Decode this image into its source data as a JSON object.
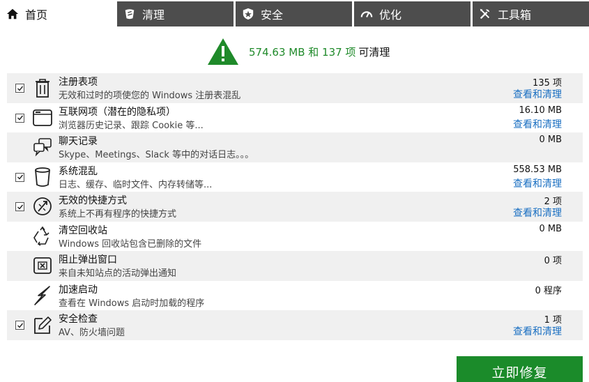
{
  "tabs": [
    {
      "label": "首页",
      "icon": "home-icon",
      "active": true
    },
    {
      "label": "清理",
      "icon": "broom-icon",
      "active": false
    },
    {
      "label": "安全",
      "icon": "shield-icon",
      "active": false
    },
    {
      "label": "优化",
      "icon": "speedometer-icon",
      "active": false
    },
    {
      "label": "工具箱",
      "icon": "tools-icon",
      "active": false
    }
  ],
  "summary": {
    "amount": "574.63 MB 和 137 项",
    "tail": "可清理",
    "icon": "warning-triangle-icon",
    "color": "#1f8a2a"
  },
  "items": [
    {
      "title": "注册表项",
      "desc": "无效和过时的项使您的 Windows 注册表混乱",
      "value": "135 项",
      "link": "查看和清理",
      "checked": true,
      "icon": "trash-icon"
    },
    {
      "title": "互联网项（潜在的隐私项）",
      "desc": "浏览器历史记录、跟踪 Cookie 等...",
      "value": "16.10 MB",
      "link": "查看和清理",
      "checked": true,
      "icon": "browser-window-icon"
    },
    {
      "title": "聊天记录",
      "desc": "Skype、Meetings、Slack 等中的对话日志。。。",
      "value": "0 MB",
      "link": "",
      "checked": false,
      "icon": "chat-icon"
    },
    {
      "title": "系统混乱",
      "desc": "日志、缓存、临时文件、内存转储等...",
      "value": "558.53 MB",
      "link": "查看和清理",
      "checked": true,
      "icon": "bin-icon"
    },
    {
      "title": "无效的快捷方式",
      "desc": "系统上不再有程序的快捷方式",
      "value": "2 项",
      "link": "查看和清理",
      "checked": true,
      "icon": "broken-link-icon"
    },
    {
      "title": "清空回收站",
      "desc": "Windows 回收站包含已删除的文件",
      "value": "0 MB",
      "link": "",
      "checked": false,
      "icon": "recycle-icon"
    },
    {
      "title": "阻止弹出窗口",
      "desc": "来自未知站点的活动弹出通知",
      "value": "0 项",
      "link": "",
      "checked": false,
      "icon": "popup-block-icon"
    },
    {
      "title": "加速启动",
      "desc": "查看在 Windows 启动时加载的程序",
      "value": "0 程序",
      "link": "",
      "checked": false,
      "icon": "lightning-icon"
    },
    {
      "title": "安全检查",
      "desc": "AV、防火墙问题",
      "value": "1 项",
      "link": "查看和清理",
      "checked": true,
      "icon": "pen-check-icon"
    }
  ],
  "fix_button": {
    "label": "立即修复",
    "color": "#1b8b2a"
  },
  "colors": {
    "tab_bg": "#4d4d4d",
    "link": "#1a6fc2",
    "row_shade": "#f0f0f0"
  }
}
